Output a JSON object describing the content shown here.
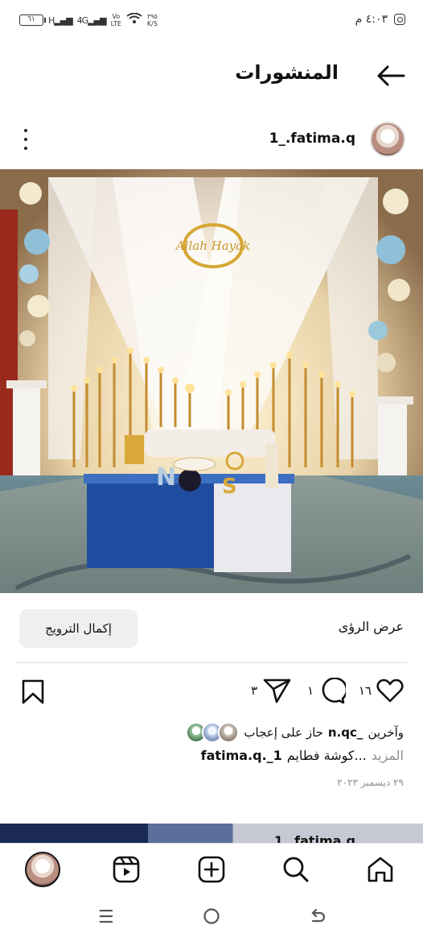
{
  "status_bar": {
    "time": "٤:٠٣ م",
    "battery": "٦١",
    "network_h": "H",
    "network_4g": "4G",
    "volte_top": "Vo",
    "volte_bottom": "LTE",
    "speed_value": "٣٩٥",
    "speed_unit": "K/S"
  },
  "header": {
    "title": "المنشورات",
    "back_icon": "arrow-left-icon"
  },
  "post": {
    "username": "1_.fatima.q",
    "image_text": "Allah Hayak",
    "insights_label": "عرض الرؤى",
    "boost_label": "إكمال الترويج",
    "likes_count": "١٦",
    "comments_count": "١",
    "shares_count": "٣",
    "liked_by_prefix": "حاز على إعجاب",
    "liked_by_user": "n.qc_",
    "liked_by_suffix": "وآخرين",
    "caption_user": "fatima.q._1",
    "caption_text": "كوشة فطايم...",
    "caption_more": "المزيد",
    "date": "٢٩ ديسمبر ٢٠٢٣"
  },
  "next_post": {
    "username": "1_.fatima.q"
  },
  "colors": {
    "accent": "#111111",
    "muted": "#8e8e8e",
    "button_bg": "#efefef"
  },
  "icons": [
    "heart-icon",
    "comment-icon",
    "share-icon",
    "bookmark-icon",
    "home-icon",
    "search-icon",
    "add-icon",
    "reels-icon",
    "more-icon"
  ]
}
